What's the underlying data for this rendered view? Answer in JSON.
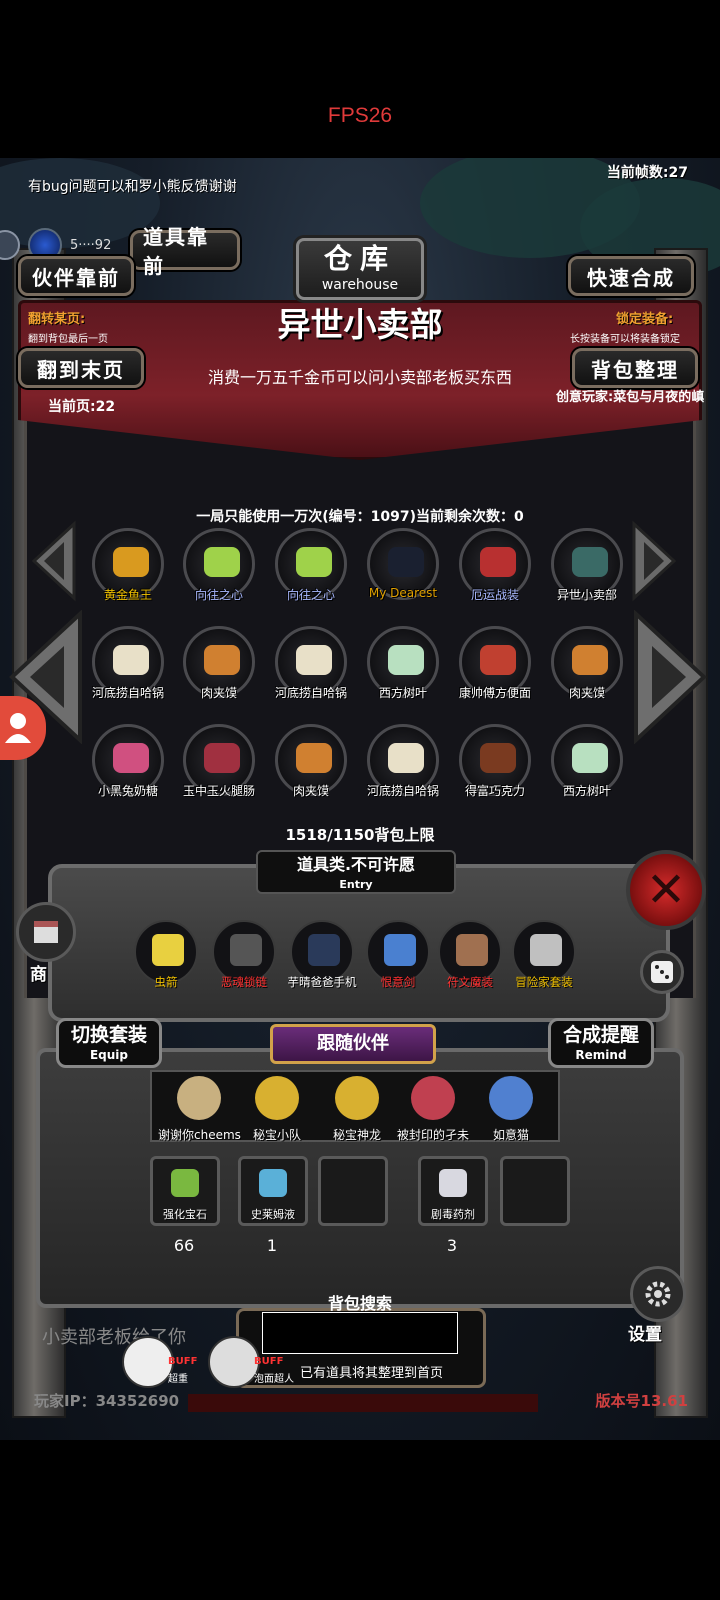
{
  "status": {
    "fps_label": "FPS26"
  },
  "hud": {
    "bug_note": "有bug问题可以和罗小熊反馈谢谢",
    "frame_count": "当前帧数:27",
    "gold": "5····92"
  },
  "warehouse": {
    "title_cn": "仓库",
    "title_en": "warehouse"
  },
  "buttons": {
    "items_front": "道具靠前",
    "partner_front": "伙伴靠前",
    "quick_craft": "快速合成",
    "last_page": "翻到末页",
    "sort_bag": "背包整理"
  },
  "labels": {
    "flip_page": "翻转某页:",
    "flip_page_hint": "翻到背包最后一页",
    "lock_equip": "锁定装备:",
    "lock_equip_hint": "长按装备可以将装备锁定",
    "current_page": "当前页:22",
    "creator": "创意玩家:菜包与月夜的嵮"
  },
  "shop": {
    "title": "异世小卖部",
    "subtitle": "消费一万五千金币可以问小卖部老板买东西",
    "usage": "一局只能使用一万次(编号：1097)当前剩余次数：0"
  },
  "items": [
    {
      "name": "黄金鱼王",
      "color": "#f0c000"
    },
    {
      "name": "向往之心",
      "color": "#a8b8ff"
    },
    {
      "name": "向往之心",
      "color": "#a8b8ff"
    },
    {
      "name": "My Dearest",
      "color": "#e0a000"
    },
    {
      "name": "厄运战装",
      "color": "#a8b8ff"
    },
    {
      "name": "异世小卖部",
      "color": "#ffffff"
    },
    {
      "name": "河底捞自哈锅",
      "color": "#ffffff"
    },
    {
      "name": "肉夹馍",
      "color": "#ffffff"
    },
    {
      "name": "河底捞自哈锅",
      "color": "#ffffff"
    },
    {
      "name": "西方树叶",
      "color": "#ffffff"
    },
    {
      "name": "康帅傅方便面",
      "color": "#ffffff"
    },
    {
      "name": "肉夹馍",
      "color": "#ffffff"
    },
    {
      "name": "小黑兔奶糖",
      "color": "#ffffff"
    },
    {
      "name": "玉中玉火腿肠",
      "color": "#ffffff"
    },
    {
      "name": "肉夹馍",
      "color": "#ffffff"
    },
    {
      "name": "河底捞自哈锅",
      "color": "#ffffff"
    },
    {
      "name": "得富巧克力",
      "color": "#ffffff"
    },
    {
      "name": "西方树叶",
      "color": "#ffffff"
    }
  ],
  "bag_capacity": "1518/1150背包上限",
  "entry": {
    "title": "道具类.不可许愿",
    "subtitle": "Entry"
  },
  "equipment": [
    {
      "name": "虫箭",
      "color": "#f0c000"
    },
    {
      "name": "恶魂锁链",
      "color": "#ff3030"
    },
    {
      "name": "芋晴爸爸手机",
      "color": "#ffffff"
    },
    {
      "name": "恨意剑",
      "color": "#ff3030"
    },
    {
      "name": "符文魔装",
      "color": "#ff3030"
    },
    {
      "name": "冒险家套装",
      "color": "#f0c000"
    }
  ],
  "equip_switch": {
    "title": "切换套装",
    "subtitle": "Equip"
  },
  "craft_remind": {
    "title": "合成提醒",
    "subtitle": "Remind"
  },
  "companions_title": "跟随伙伴",
  "companions": [
    {
      "name": "谢谢你cheems"
    },
    {
      "name": "秘宝小队"
    },
    {
      "name": "秘宝神龙"
    },
    {
      "name": "被封印的孑未"
    },
    {
      "name": "如意猫"
    }
  ],
  "slots": [
    {
      "name": "强化宝石",
      "count": "66"
    },
    {
      "name": "史莱姆液",
      "count": "1"
    },
    {
      "name": "",
      "count": ""
    },
    {
      "name": "剧毒药剂",
      "count": "3"
    },
    {
      "name": "",
      "count": ""
    }
  ],
  "search": {
    "label": "背包搜索",
    "value": ""
  },
  "scroll_message": "小卖部老板给了你",
  "buffs": [
    {
      "tag": "BUFF",
      "sub": "超重"
    },
    {
      "tag": "BUFF",
      "sub": "泡面超人"
    }
  ],
  "bottom_hint": "已有道具将其整理到首页",
  "shop_side_label": "商",
  "settings_label": "设置",
  "player_id": "玩家IP：34352690",
  "version": "版本号13.61"
}
